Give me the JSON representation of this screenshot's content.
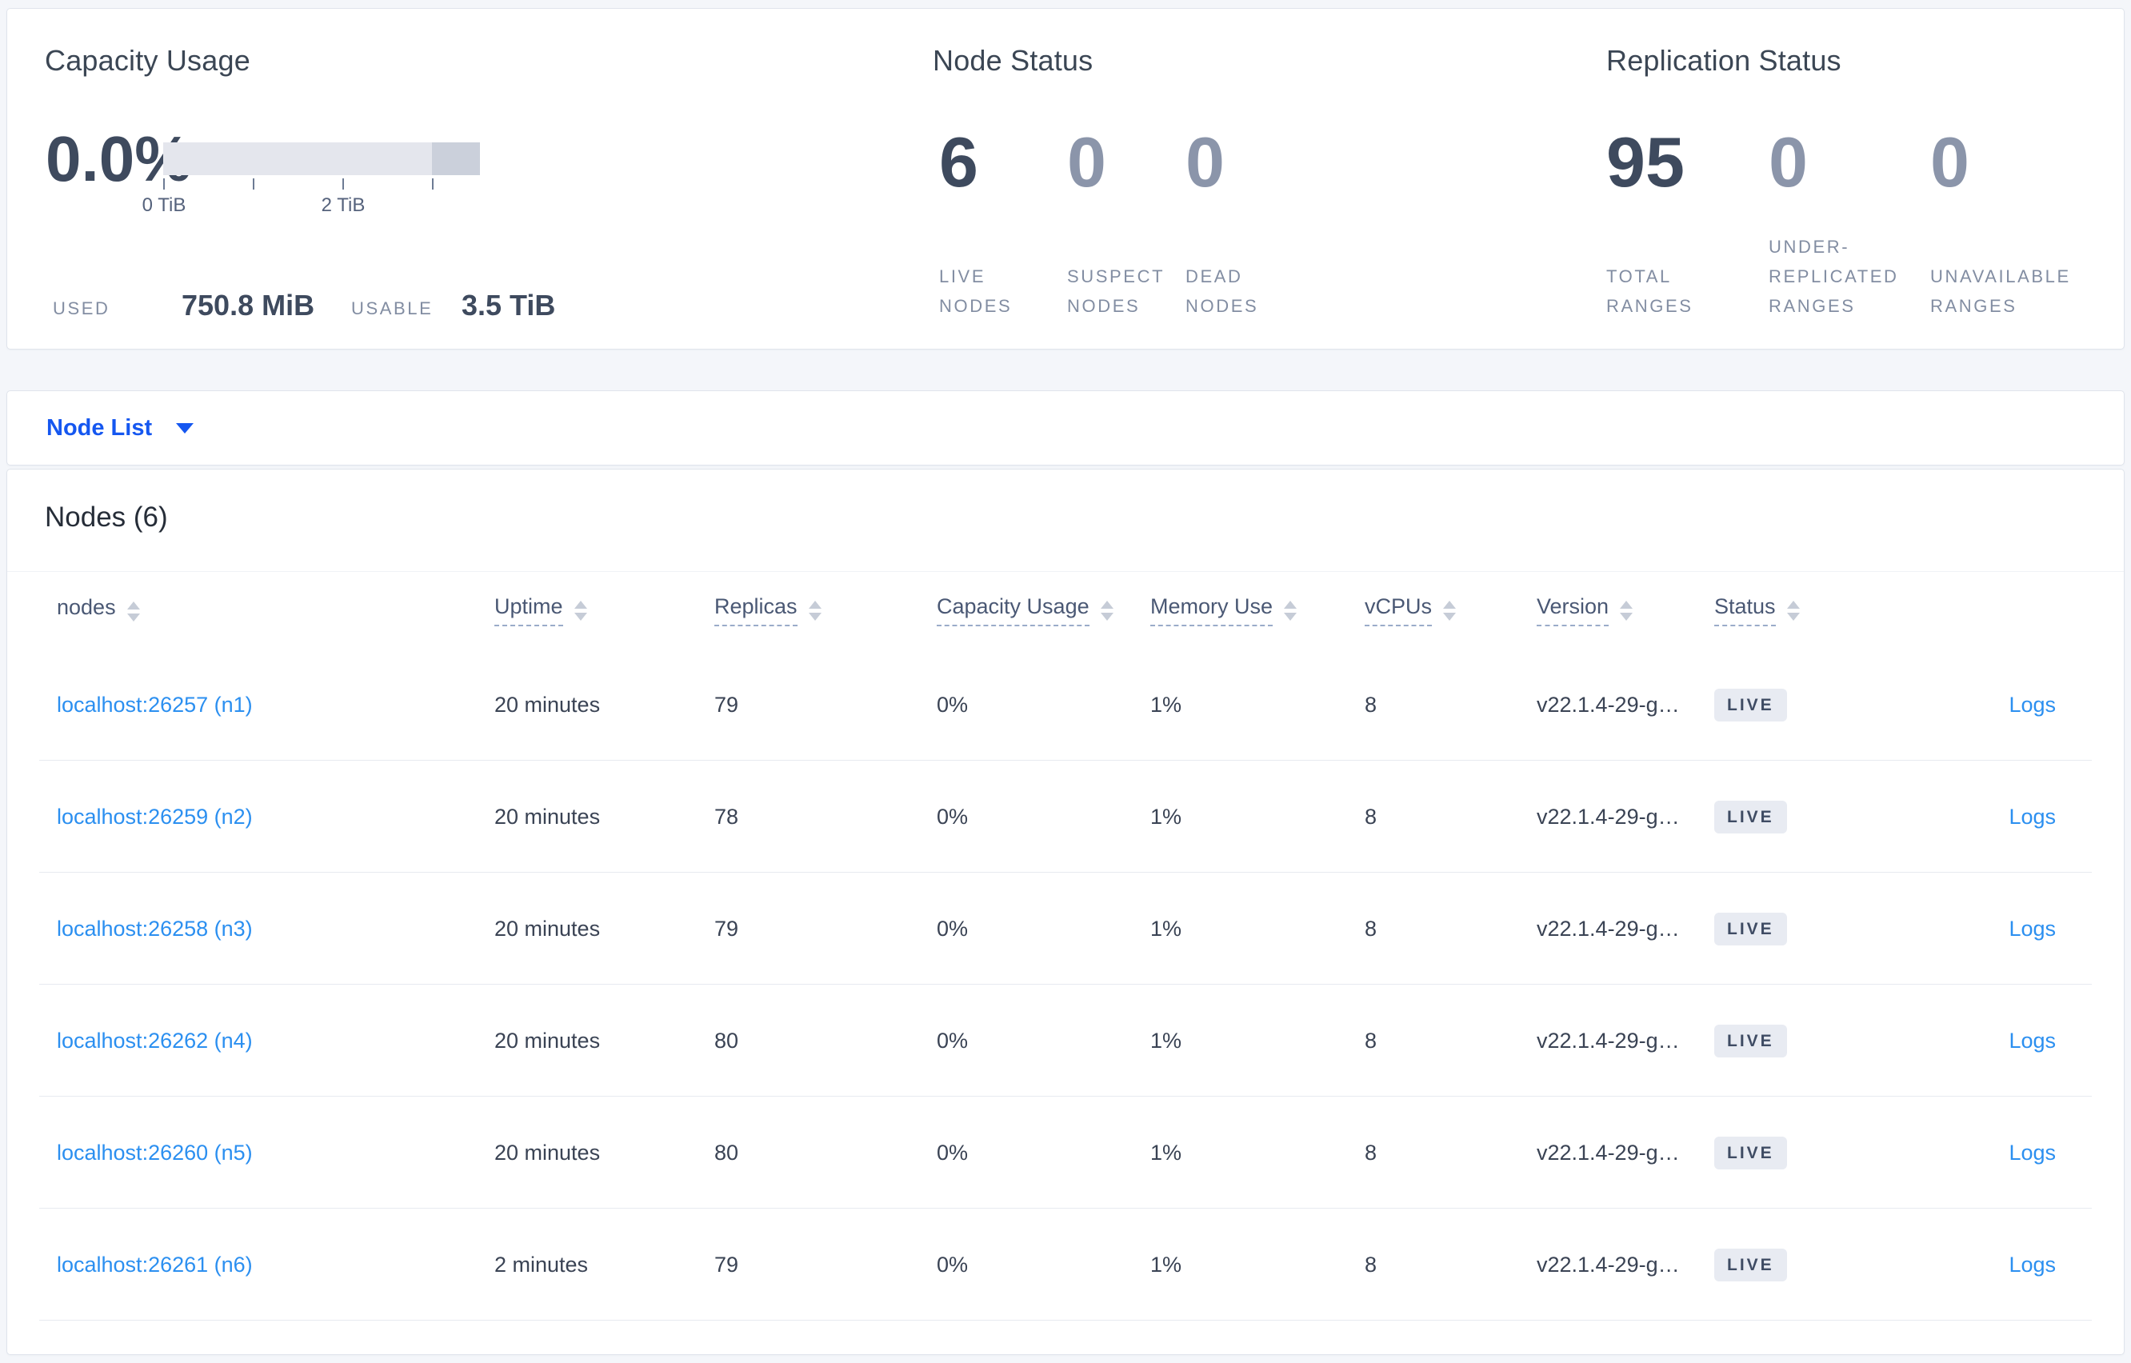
{
  "capacity": {
    "title": "Capacity Usage",
    "percent": "0.0%",
    "tick_labels": [
      "0 TiB",
      "2 TiB"
    ],
    "used_label": "USED",
    "used_value": "750.8 MiB",
    "usable_label": "USABLE",
    "usable_value": "3.5 TiB"
  },
  "node_status": {
    "title": "Node Status",
    "stats": [
      {
        "value": "6",
        "label": "LIVE NODES"
      },
      {
        "value": "0",
        "label": "SUSPECT NODES"
      },
      {
        "value": "0",
        "label": "DEAD NODES"
      }
    ]
  },
  "replication_status": {
    "title": "Replication Status",
    "stats": [
      {
        "value": "95",
        "label": "TOTAL RANGES"
      },
      {
        "value": "0",
        "label": "UNDER-REPLICATED RANGES"
      },
      {
        "value": "0",
        "label": "UNAVAILABLE RANGES"
      }
    ]
  },
  "node_list": {
    "label": "Node List"
  },
  "nodes_table": {
    "title": "Nodes (6)",
    "columns": [
      {
        "label": "nodes"
      },
      {
        "label": "Uptime"
      },
      {
        "label": "Replicas"
      },
      {
        "label": "Capacity Usage"
      },
      {
        "label": "Memory Use"
      },
      {
        "label": "vCPUs"
      },
      {
        "label": "Version"
      },
      {
        "label": "Status"
      }
    ],
    "rows": [
      {
        "node": "localhost:26257 (n1)",
        "uptime": "20 minutes",
        "replicas": "79",
        "capacity": "0%",
        "memory": "1%",
        "vcpus": "8",
        "version": "v22.1.4-29-g…",
        "status": "LIVE",
        "logs": "Logs"
      },
      {
        "node": "localhost:26259 (n2)",
        "uptime": "20 minutes",
        "replicas": "78",
        "capacity": "0%",
        "memory": "1%",
        "vcpus": "8",
        "version": "v22.1.4-29-g…",
        "status": "LIVE",
        "logs": "Logs"
      },
      {
        "node": "localhost:26258 (n3)",
        "uptime": "20 minutes",
        "replicas": "79",
        "capacity": "0%",
        "memory": "1%",
        "vcpus": "8",
        "version": "v22.1.4-29-g…",
        "status": "LIVE",
        "logs": "Logs"
      },
      {
        "node": "localhost:26262 (n4)",
        "uptime": "20 minutes",
        "replicas": "80",
        "capacity": "0%",
        "memory": "1%",
        "vcpus": "8",
        "version": "v22.1.4-29-g…",
        "status": "LIVE",
        "logs": "Logs"
      },
      {
        "node": "localhost:26260 (n5)",
        "uptime": "20 minutes",
        "replicas": "80",
        "capacity": "0%",
        "memory": "1%",
        "vcpus": "8",
        "version": "v22.1.4-29-g…",
        "status": "LIVE",
        "logs": "Logs"
      },
      {
        "node": "localhost:26261 (n6)",
        "uptime": "2 minutes",
        "replicas": "79",
        "capacity": "0%",
        "memory": "1%",
        "vcpus": "8",
        "version": "v22.1.4-29-g…",
        "status": "LIVE",
        "logs": "Logs"
      }
    ]
  },
  "colors": {
    "accent_blue": "#1557f0",
    "link_blue": "#2b8ff0",
    "bar_track": "#e4e6ed",
    "bar_dark_segment": "#cbd0db",
    "badge_bg": "#e8ebf2"
  }
}
